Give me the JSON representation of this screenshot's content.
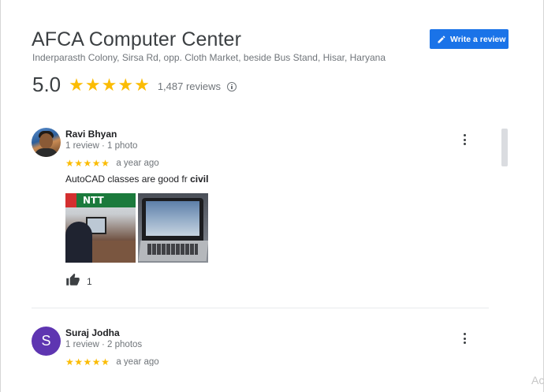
{
  "place": {
    "title": "AFCA Computer Center",
    "address": "Inderparasth Colony, Sirsa Rd, opp. Cloth Market, beside Bus Stand, Hisar, Haryana",
    "rating": "5.0",
    "stars": 5,
    "review_count_label": "1,487 reviews"
  },
  "actions": {
    "write_review_label": "Write a review"
  },
  "icons": {
    "pencil": "pencil-icon",
    "info": "info-icon",
    "more": "more-vert-icon",
    "thumb": "thumb-up-icon",
    "star": "star-icon"
  },
  "colors": {
    "accent": "#1a73e8",
    "star": "#fbbc04",
    "avatar_s": "#5e35b1"
  },
  "reviews": [
    {
      "name": "Ravi Bhyan",
      "meta": "1 review · 1 photo",
      "stars": 5,
      "time": "a year ago",
      "text_prefix": "AutoCAD classes are good fr ",
      "text_bold": "civil",
      "photo_badge": "NTT",
      "likes": "1"
    },
    {
      "name": "Suraj Jodha",
      "avatar_letter": "S",
      "meta": "1 review · 2 photos",
      "stars": 5,
      "time": "a year ago"
    }
  ],
  "corner_text": "Ac"
}
